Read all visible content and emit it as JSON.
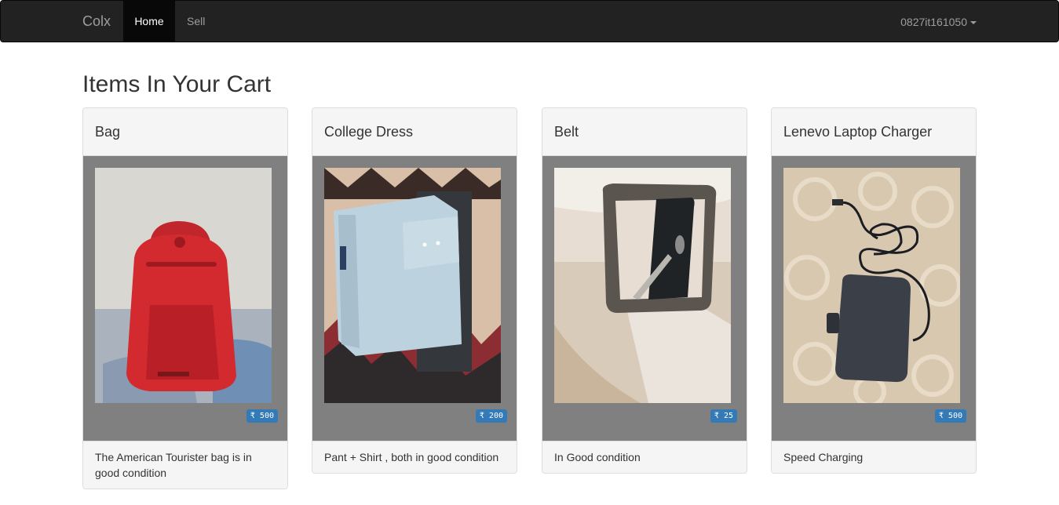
{
  "navbar": {
    "brand": "Colx",
    "links": [
      {
        "label": "Home",
        "active": true
      },
      {
        "label": "Sell",
        "active": false
      }
    ],
    "user": "0827it161050"
  },
  "page": {
    "title": "Items In Your Cart"
  },
  "cart": {
    "items": [
      {
        "name": "Bag",
        "price": "₹ 500",
        "description": "The American Tourister bag is in good condition",
        "photo": "red-backpack"
      },
      {
        "name": "College Dress",
        "price": "₹ 200",
        "description": "Pant + Shirt , both in good condition",
        "photo": "folded-shirt"
      },
      {
        "name": "Belt",
        "price": "₹ 25",
        "description": "In Good condition",
        "photo": "belt-buckle"
      },
      {
        "name": "Lenevo Laptop Charger",
        "price": "₹ 500",
        "description": "Speed Charging",
        "photo": "laptop-charger"
      }
    ]
  },
  "colors": {
    "navbar_bg": "#222222",
    "price_badge": "#337ab7",
    "card_body": "#808080"
  }
}
